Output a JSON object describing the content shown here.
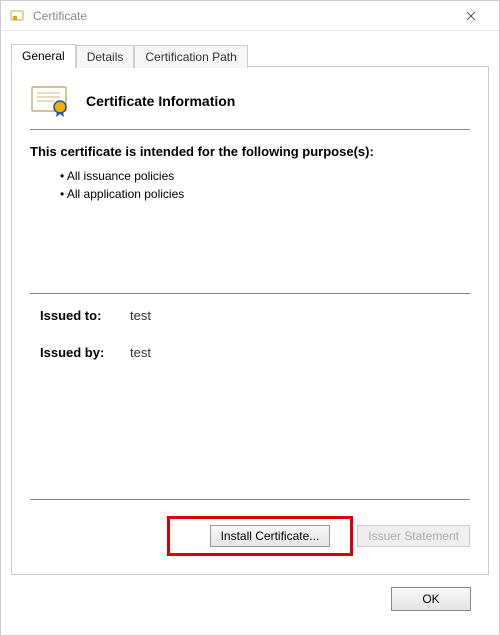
{
  "window": {
    "title": "Certificate"
  },
  "tabs": {
    "general": "General",
    "details": "Details",
    "certpath": "Certification Path"
  },
  "general_panel": {
    "heading": "Certificate Information",
    "purpose_heading": "This certificate is intended for the following purpose(s):",
    "purposes": {
      "p0": "All issuance policies",
      "p1": "All application policies"
    },
    "issued_to_label": "Issued to:",
    "issued_to_value": "test",
    "issued_by_label": "Issued by:",
    "issued_by_value": "test",
    "install_btn": "Install Certificate...",
    "issuer_stmt_btn": "Issuer Statement"
  },
  "footer": {
    "ok": "OK"
  }
}
